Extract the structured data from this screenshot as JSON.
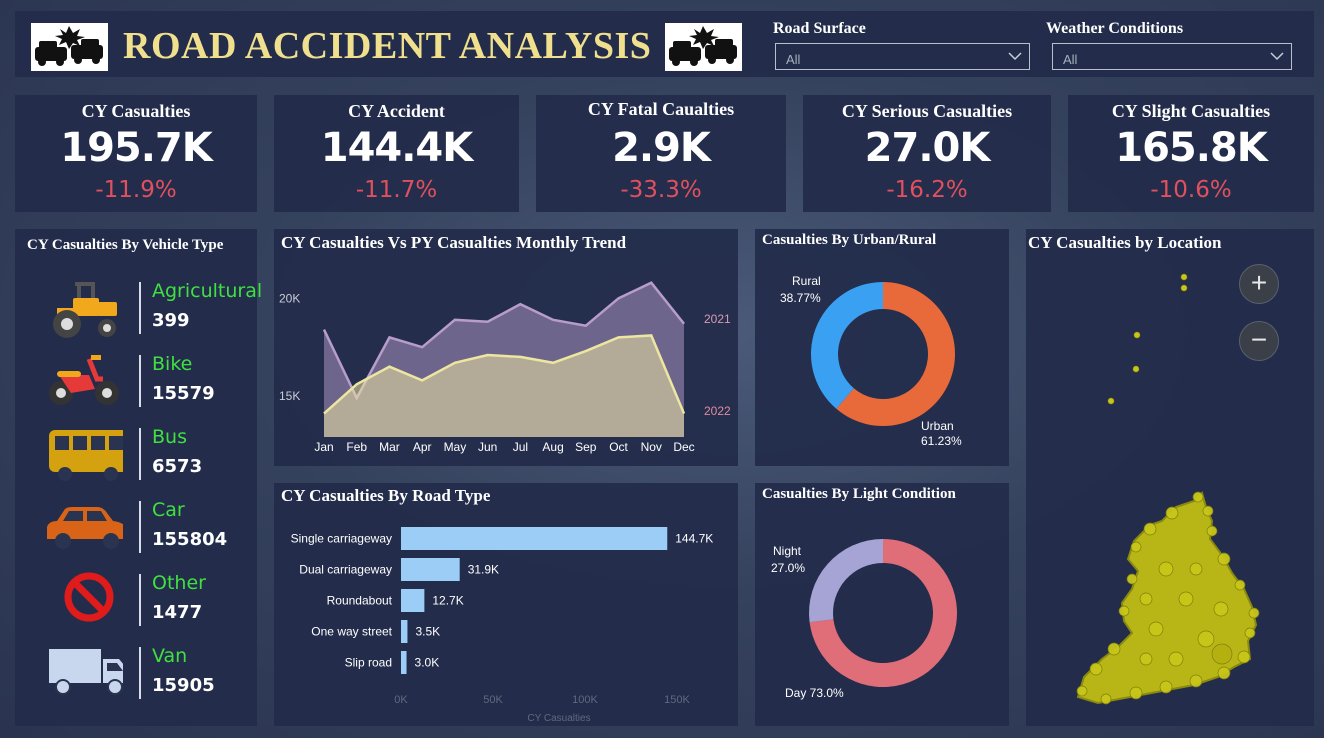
{
  "header": {
    "title": "ROAD ACCIDENT ANALYSIS"
  },
  "filters": {
    "road_surface": {
      "label": "Road Surface",
      "value": "All"
    },
    "weather": {
      "label": "Weather Conditions",
      "value": "All"
    }
  },
  "kpis": [
    {
      "title": "CY Casualties",
      "value": "195.7K",
      "delta": "-11.9%"
    },
    {
      "title": "CY Accident",
      "value": "144.4K",
      "delta": "-11.7%"
    },
    {
      "title": "CY Fatal Caualties",
      "value": "2.9K",
      "delta": "-33.3%"
    },
    {
      "title": "CY Serious Casualties",
      "value": "27.0K",
      "delta": "-16.2%"
    },
    {
      "title": "CY Slight Casualties",
      "value": "165.8K",
      "delta": "-10.6%"
    }
  ],
  "vehicles": {
    "title": "CY Casualties By Vehicle Type",
    "items": [
      {
        "name": "Agricultural",
        "value": "399",
        "icon": "tractor-icon"
      },
      {
        "name": "Bike",
        "value": "15579",
        "icon": "motorbike-icon"
      },
      {
        "name": "Bus",
        "value": "6573",
        "icon": "bus-icon"
      },
      {
        "name": "Car",
        "value": "155804",
        "icon": "car-icon"
      },
      {
        "name": "Other",
        "value": "1477",
        "icon": "prohibited-icon"
      },
      {
        "name": "Van",
        "value": "15905",
        "icon": "van-icon"
      }
    ]
  },
  "trend": {
    "title": "CY Casualties Vs PY Casualties Monthly Trend",
    "chart_data": {
      "type": "area",
      "categories": [
        "Jan",
        "Feb",
        "Mar",
        "Apr",
        "May",
        "Jun",
        "Jul",
        "Aug",
        "Sep",
        "Oct",
        "Nov",
        "Dec"
      ],
      "yticks": [
        15000,
        20000
      ],
      "ytick_labels": [
        "15K",
        "20K"
      ],
      "ylim": [
        12900,
        21400
      ],
      "series": [
        {
          "name": "2021",
          "color": "#b89ccb",
          "values": [
            18400,
            14900,
            18000,
            17500,
            18900,
            18800,
            19700,
            18900,
            18600,
            20000,
            20800,
            18700
          ]
        },
        {
          "name": "2022",
          "color": "#ece6a0",
          "values": [
            14100,
            15600,
            16500,
            15800,
            16700,
            17100,
            17000,
            16700,
            17300,
            18000,
            18100,
            14100
          ]
        }
      ]
    }
  },
  "road_type": {
    "title": "CY Casualties By Road Type",
    "chart_data": {
      "type": "bar",
      "orientation": "horizontal",
      "categories": [
        "Single carriageway",
        "Dual carriageway",
        "Roundabout",
        "One way street",
        "Slip road"
      ],
      "values": [
        144700,
        31900,
        12700,
        3500,
        3000
      ],
      "value_labels": [
        "144.7K",
        "31.9K",
        "12.7K",
        "3.5K",
        "3.0K"
      ],
      "xticks": [
        0,
        50000,
        100000,
        150000
      ],
      "xtick_labels": [
        "0K",
        "50K",
        "100K",
        "150K"
      ],
      "xlabel": "CY Casualties",
      "xlim": [
        0,
        150000
      ],
      "color": "#9ccdf6"
    }
  },
  "urban_rural": {
    "title": "Casualties By Urban/Rural",
    "chart_data": {
      "type": "pie",
      "slices": [
        {
          "name": "Urban",
          "value": 61.23,
          "label": "61.23%",
          "color": "#e8693a"
        },
        {
          "name": "Rural",
          "value": 38.77,
          "label": "38.77%",
          "color": "#3aa0f2"
        }
      ]
    }
  },
  "light": {
    "title": "Casualties By Light Condition",
    "chart_data": {
      "type": "pie",
      "slices": [
        {
          "name": "Day",
          "value": 73.0,
          "label": "Day 73.0%",
          "color": "#e06e78"
        },
        {
          "name": "Night",
          "value": 27.0,
          "label": "27.0%",
          "color": "#a6a4d4"
        }
      ]
    }
  },
  "location": {
    "title": "CY Casualties by Location",
    "zoom_in": "+",
    "zoom_out": "−"
  }
}
